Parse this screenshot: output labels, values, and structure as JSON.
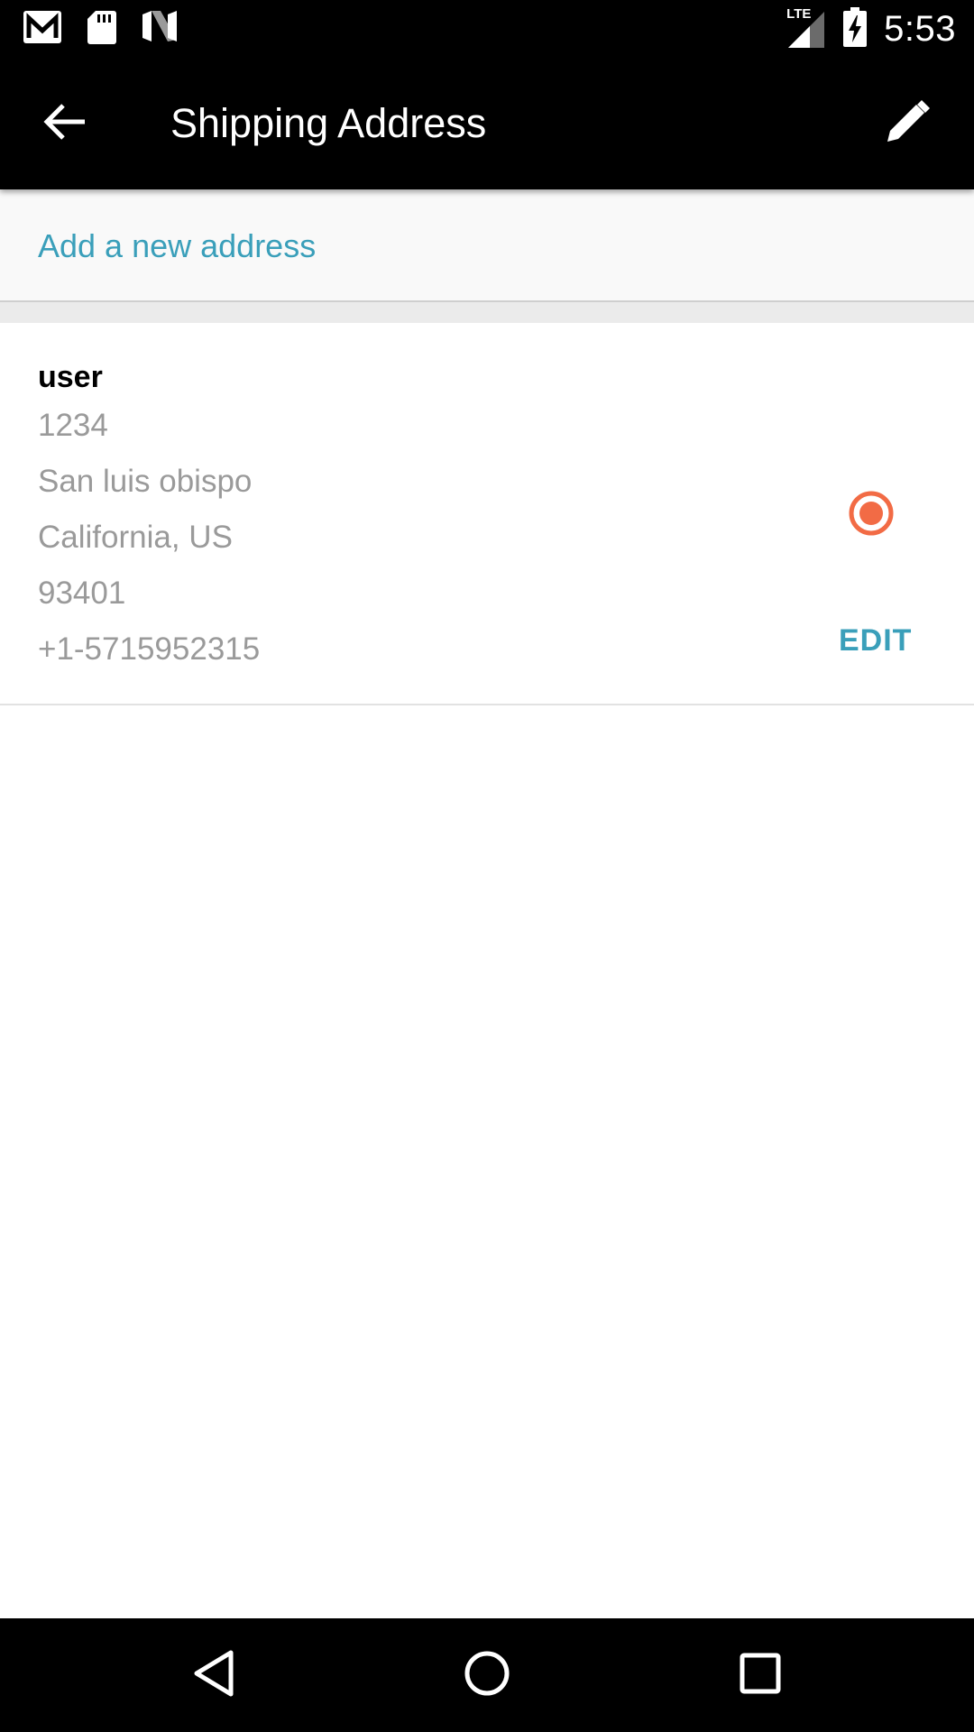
{
  "status_bar": {
    "time": "5:53",
    "network_label": "LTE",
    "left_icons": [
      "gmail-icon",
      "sd-card-icon",
      "n-logo-icon"
    ],
    "right_icons": [
      "signal-icon",
      "battery-charging-icon"
    ]
  },
  "app_bar": {
    "title": "Shipping Address",
    "back_icon": "arrow-back-icon",
    "action_icon": "pencil-icon"
  },
  "add_address": {
    "label": "Add a new address"
  },
  "addresses": [
    {
      "name": "user",
      "line1": "1234",
      "city": "San luis obispo",
      "region": "California, US",
      "zip": "93401",
      "phone": "+1-5715952315",
      "selected": true,
      "edit_label": "EDIT"
    }
  ],
  "colors": {
    "accent": "#3a9fba",
    "radio": "#f26b45",
    "bar": "#000000"
  },
  "nav_bar": {
    "icons": [
      "back-triangle-icon",
      "home-circle-icon",
      "recents-square-icon"
    ]
  }
}
